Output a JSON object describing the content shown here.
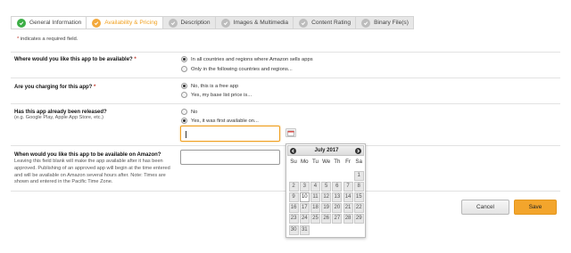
{
  "tabs": [
    {
      "label": "General Information",
      "state": "done"
    },
    {
      "label": "Availability & Pricing",
      "state": "active"
    },
    {
      "label": "Description",
      "state": "pending"
    },
    {
      "label": "Images & Multimedia",
      "state": "pending"
    },
    {
      "label": "Content Rating",
      "state": "pending"
    },
    {
      "label": "Binary File(s)",
      "state": "pending"
    }
  ],
  "required_note": {
    "star": "*",
    "text": " indicates a required field."
  },
  "availability": {
    "question": "Where would you like this app to be available?",
    "star": " *",
    "options": [
      {
        "label": "In all countries and regions where Amazon sells apps",
        "selected": true
      },
      {
        "label": "Only in the following countries and regions...",
        "selected": false
      }
    ]
  },
  "charging": {
    "question": "Are you charging for this app?",
    "star": " *",
    "options": [
      {
        "label": "No, this is a free app",
        "selected": true
      },
      {
        "label": "Yes, my base list price is...",
        "selected": false
      }
    ]
  },
  "released": {
    "question": "Has this app already been released?",
    "sub": "(e.g. Google Play, Apple App Store, etc.)",
    "options": [
      {
        "label": "No",
        "selected": false
      },
      {
        "label": "Yes, it was first available on...",
        "selected": true
      }
    ],
    "date_value": ""
  },
  "amazon_availability": {
    "question": "When would you like this app to be available on Amazon?",
    "description": "Leaving this field blank will make the app available after it has been approved. Publishing of an approved app will begin at the time entered and will be available on Amazon several hours after. Note: Times are shown and entered in the Pacific Time Zone.",
    "value": ""
  },
  "calendar": {
    "title": "July 2017",
    "weekdays": [
      "Su",
      "Mo",
      "Tu",
      "We",
      "Th",
      "Fr",
      "Sa"
    ],
    "first_weekday_index": 6,
    "days_in_month": 31,
    "today": 10
  },
  "buttons": {
    "cancel": "Cancel",
    "save": "Save"
  },
  "colors": {
    "accent": "#f3a52c",
    "done": "#3cae46",
    "required": "#c0392b"
  }
}
